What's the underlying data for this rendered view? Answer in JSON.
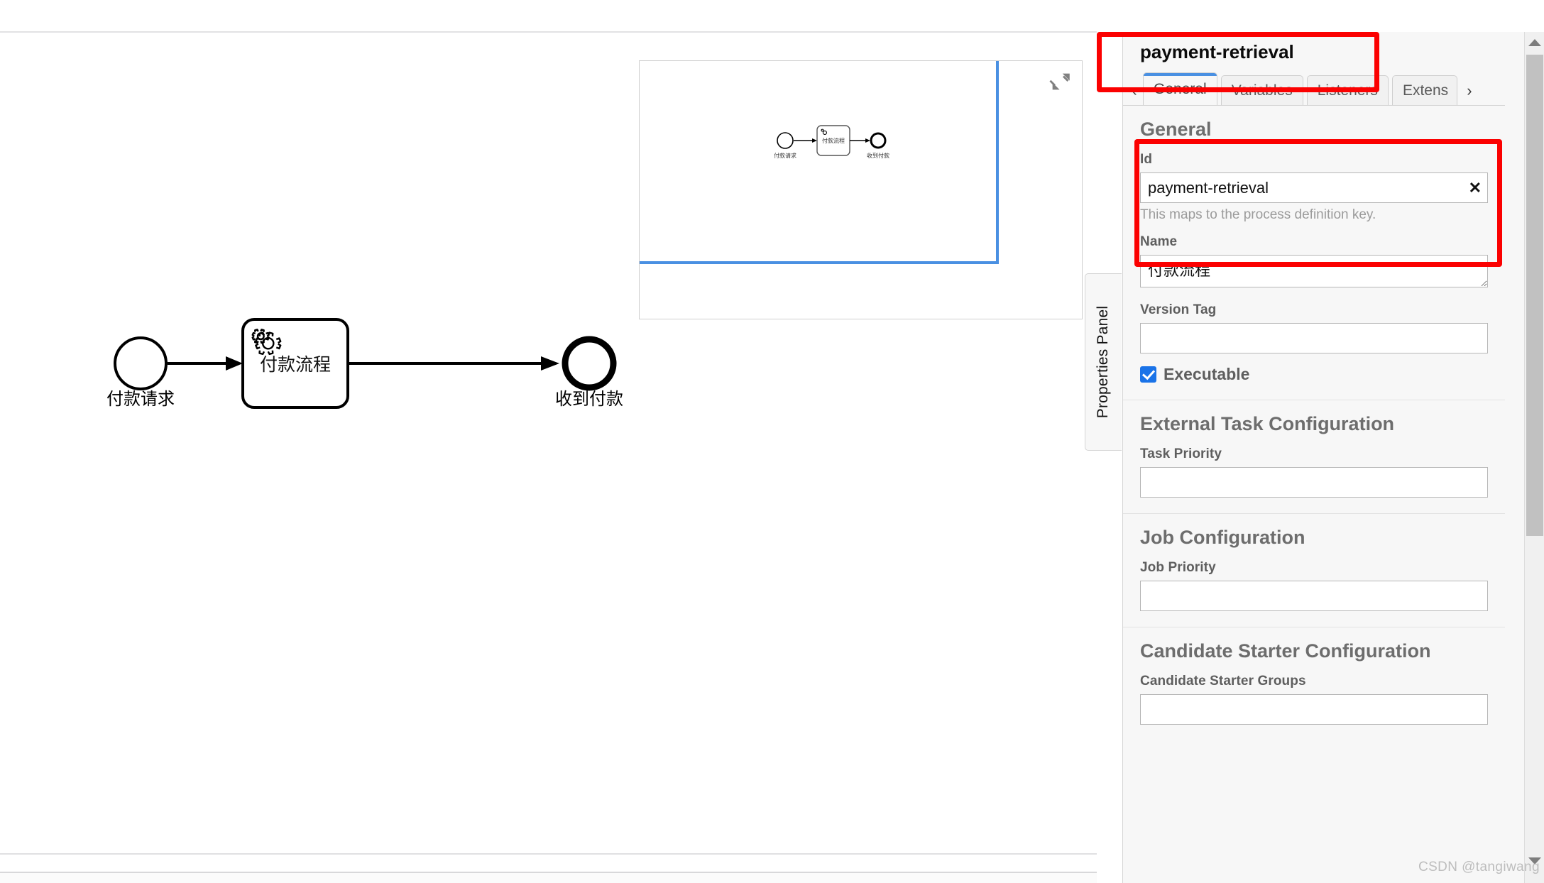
{
  "app": {
    "watermark": "CSDN @tangiwang"
  },
  "canvas": {
    "diagram": {
      "type": "bpmn",
      "start_event_label": "付款请求",
      "task_label": "付款流程",
      "task_icon": "service-task-gears-icon",
      "end_event_label": "收到付款"
    },
    "minimap": {
      "toggle_icon": "collapse-arrows-icon",
      "start_event_label": "付款请求",
      "task_label": "付款流程",
      "end_event_label": "收到付款"
    },
    "properties_tab_label": "Properties Panel"
  },
  "panel": {
    "title": "payment-retrieval",
    "tabs": {
      "prev_arrow": "‹",
      "next_arrow": "›",
      "items": [
        {
          "label": "General",
          "active": true
        },
        {
          "label": "Variables",
          "active": false
        },
        {
          "label": "Listeners",
          "active": false
        },
        {
          "label": "Extens",
          "active": false
        }
      ]
    },
    "groups": [
      {
        "heading": "General",
        "fields": [
          {
            "label": "Id",
            "value": "payment-retrieval",
            "clear_icon": "✕",
            "hint": "This maps to the process definition key."
          },
          {
            "label": "Name",
            "value": "付款流程"
          },
          {
            "label": "Version Tag",
            "value": ""
          }
        ],
        "checkbox": {
          "label": "Executable",
          "checked": true
        }
      },
      {
        "heading": "External Task Configuration",
        "fields": [
          {
            "label": "Task Priority",
            "value": ""
          }
        ]
      },
      {
        "heading": "Job Configuration",
        "fields": [
          {
            "label": "Job Priority",
            "value": ""
          }
        ]
      },
      {
        "heading": "Candidate Starter Configuration",
        "fields": [
          {
            "label": "Candidate Starter Groups",
            "value": ""
          }
        ]
      }
    ],
    "accent_color": "#4a90e2",
    "highlight_color": "#fb0101"
  }
}
